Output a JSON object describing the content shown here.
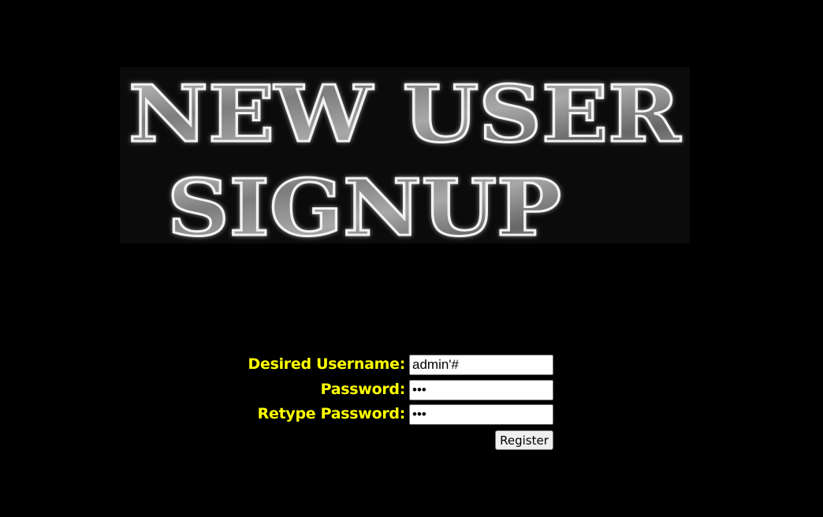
{
  "banner": {
    "line1": "NEW USER",
    "line2": "SIGNUP"
  },
  "form": {
    "username_label": "Desired Username:",
    "username_value": "admin'#",
    "password_label": "Password:",
    "password_value": "abc",
    "retype_label": "Retype Password:",
    "retype_value": "abc",
    "register_label": "Register"
  },
  "colors": {
    "background": "#000000",
    "label": "#ffff00",
    "banner_metal": "#8a8a8a"
  }
}
